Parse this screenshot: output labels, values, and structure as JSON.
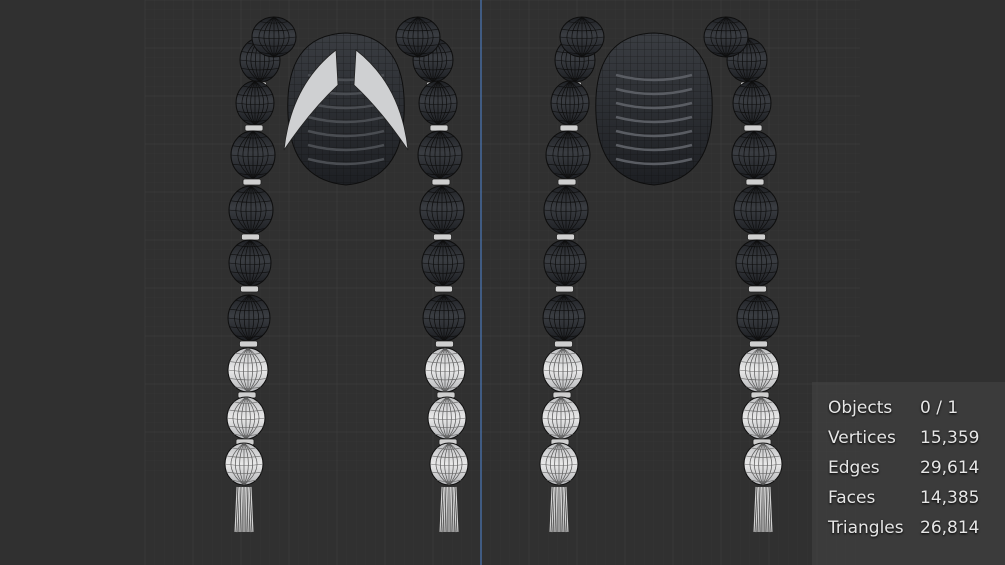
{
  "viewport": {
    "background_color": "#303030",
    "grid_color": "#3a3a3a",
    "y_axis_color": "#4a78b8",
    "mesh_dark_color": "#2b2d31",
    "mesh_light_color": "#d8d8d8",
    "wire_color": "#0e0e0e"
  },
  "statistics": {
    "rows": [
      {
        "label": "Objects",
        "value": "0 / 1"
      },
      {
        "label": "Vertices",
        "value": "15,359"
      },
      {
        "label": "Edges",
        "value": "29,614"
      },
      {
        "label": "Faces",
        "value": "14,385"
      },
      {
        "label": "Triangles",
        "value": "26,814"
      }
    ]
  }
}
